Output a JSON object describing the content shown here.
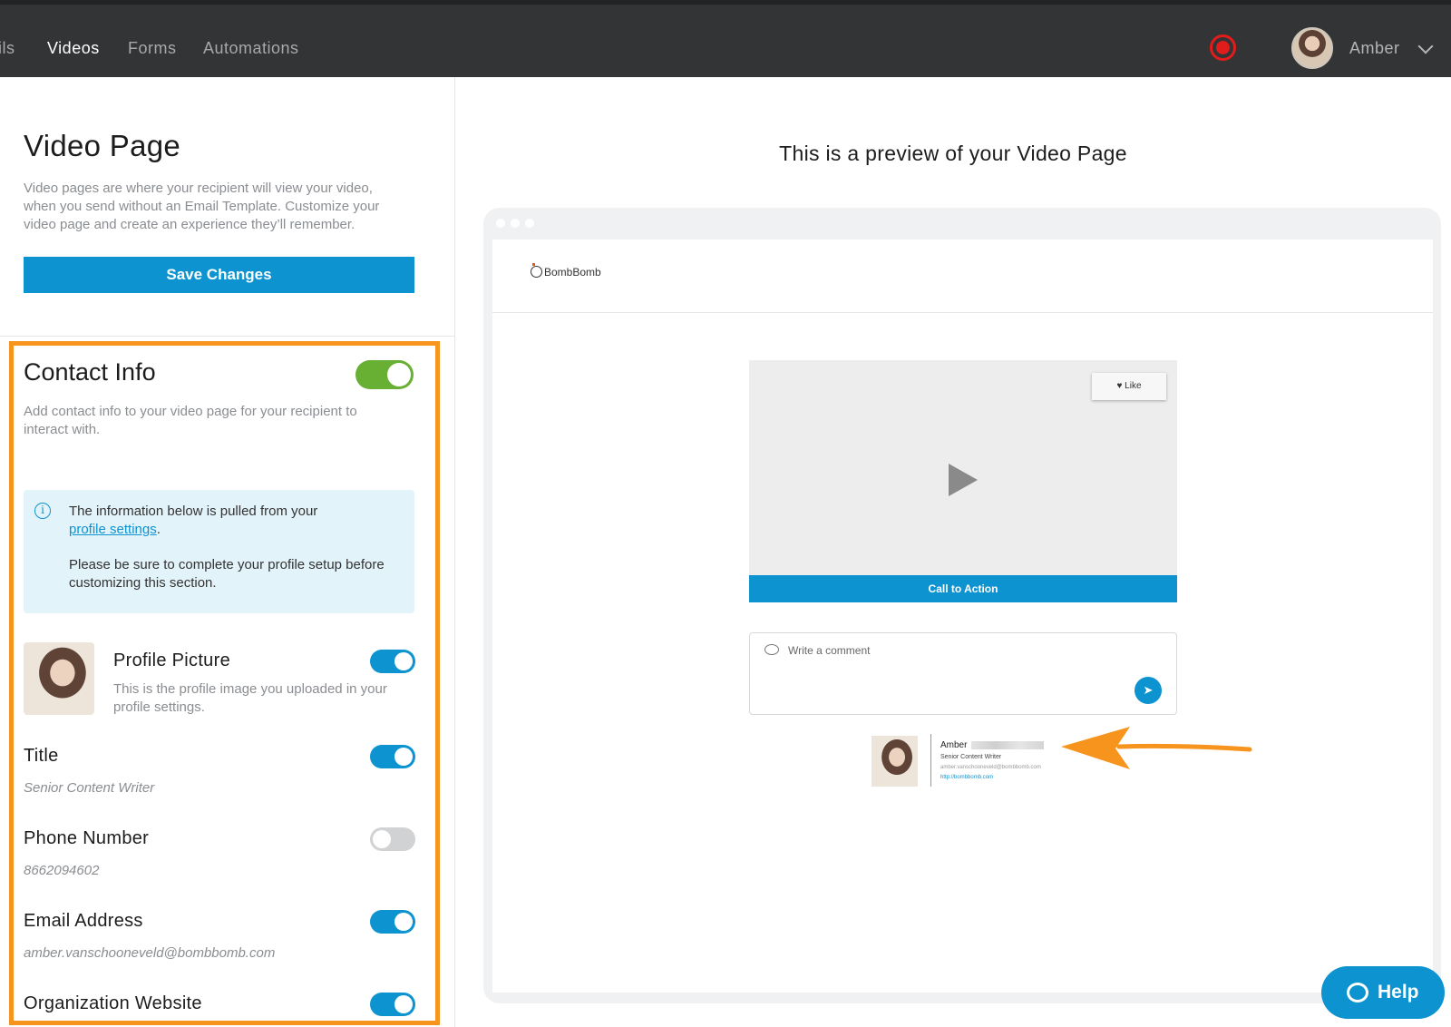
{
  "nav": {
    "items": [
      "ils",
      "Videos",
      "Forms",
      "Automations"
    ],
    "active": "Videos",
    "user_name": "Amber"
  },
  "settings": {
    "title": "Video Page",
    "description": "Video pages are where your recipient will view your video, when you send without an Email Template. Customize your video page and create an experience they’ll remember.",
    "save_label": "Save Changes"
  },
  "contact": {
    "title": "Contact Info",
    "description": "Add contact info to your video page for your recipient to interact with.",
    "enabled": true,
    "info_line1": "The information below is pulled from your",
    "info_link": "profile settings",
    "info_period": ".",
    "info_line2": "Please be sure to complete your profile setup before customizing this section.",
    "fields": [
      {
        "label": "Profile Picture",
        "description": "This is the profile image you uploaded in your profile settings.",
        "enabled": true
      },
      {
        "label": "Title",
        "value": "Senior Content Writer",
        "enabled": true
      },
      {
        "label": "Phone Number",
        "value": "8662094602",
        "enabled": false
      },
      {
        "label": "Email Address",
        "value": "amber.vanschooneveld@bombbomb.com",
        "enabled": true
      },
      {
        "label": "Organization Website",
        "enabled": true
      }
    ]
  },
  "preview": {
    "heading": "This is a preview of your Video Page",
    "logo_text": "BombBomb",
    "like_label": "Like",
    "cta_label": "Call to Action",
    "comment_placeholder": "Write a comment",
    "signature": {
      "name": "Amber",
      "title": "Senior Content Writer",
      "email": "amber.vanschooneveld@bombbomb.com",
      "url": "http://bombbomb.com"
    }
  },
  "help": {
    "label": "Help"
  },
  "colors": {
    "accent": "#0d93d0",
    "toggle_green": "#67b033",
    "highlight": "#f7941d",
    "record": "#e21b1b"
  }
}
